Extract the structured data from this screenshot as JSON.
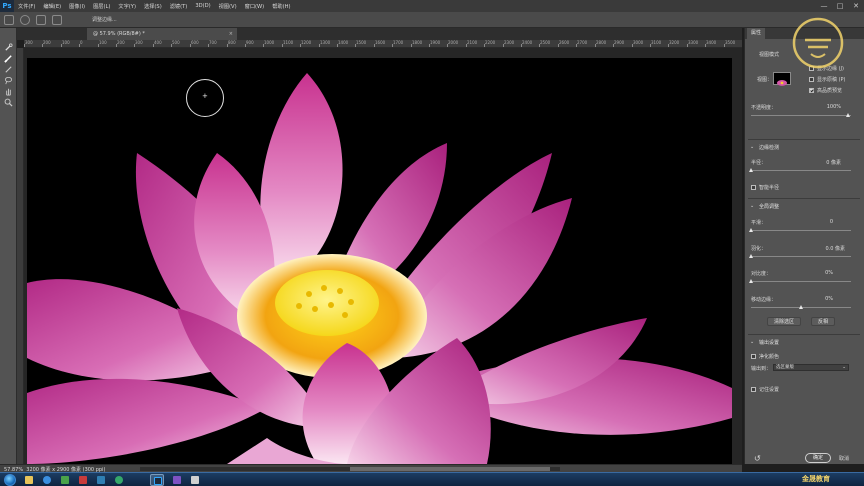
{
  "app": {
    "logo": "Ps"
  },
  "menubar": {
    "items": [
      "文件(F)",
      "编辑(E)",
      "图像(I)",
      "图层(L)",
      "文字(Y)",
      "选择(S)",
      "滤镜(T)",
      "3D(D)",
      "视图(V)",
      "窗口(W)",
      "帮助(H)"
    ],
    "window_controls": [
      "—",
      "□",
      "✕"
    ]
  },
  "options_bar": {
    "partial_label": "调整边缘..."
  },
  "document": {
    "tab_label": "@ 57.9% (RGB/8#) *",
    "close": "×"
  },
  "ruler_h": {
    "ticks": [
      "300",
      "200",
      "100",
      "0",
      "100",
      "200",
      "300",
      "400",
      "500",
      "600",
      "700",
      "800",
      "900",
      "1000",
      "1100",
      "1200",
      "1300",
      "1400",
      "1500",
      "1600",
      "1700",
      "1800",
      "1900",
      "2000",
      "2100",
      "2200",
      "2300",
      "2400",
      "2500",
      "2600",
      "2700",
      "2800",
      "2900",
      "3000",
      "3100",
      "3200",
      "3300",
      "3400",
      "3500"
    ]
  },
  "status": {
    "zoom": "57.87%",
    "doc_size": "3200 像素 x 2900 像素 (300 ppi)"
  },
  "panel": {
    "tab": "属性",
    "view_mode": {
      "title": "视图模式",
      "view_label": "视图：",
      "show_edge": "显示边缘 (J)",
      "show_original": "显示原稿 (P)",
      "high_quality": "高品质预览",
      "show_edge_checked": false,
      "show_original_checked": false,
      "high_quality_checked": true
    },
    "opacity": {
      "label": "不透明度：",
      "value": "100%"
    },
    "edge_detection": {
      "title": "边缘检测",
      "radius_label": "半径：",
      "radius_value": "0 像素",
      "smart_radius": "智能半径",
      "smart_radius_checked": false
    },
    "global_refine": {
      "title": "全局调整",
      "smooth_label": "平滑：",
      "smooth_value": "0",
      "feather_label": "羽化：",
      "feather_value": "0.0 像素",
      "contrast_label": "对比度：",
      "contrast_value": "0%",
      "shift_edge_label": "移动边缘：",
      "shift_edge_value": "0%"
    },
    "buttons": {
      "clear_selection": "清除选区",
      "invert": "反相"
    },
    "output": {
      "title": "输出设置",
      "decontaminate": "净化颜色",
      "decontaminate_checked": false,
      "output_to_label": "输出到：",
      "output_to_value": "选区蒙版",
      "remember": "记住设置",
      "remember_checked": false
    },
    "ok": "确定",
    "cancel": "取消"
  },
  "watermark": {
    "brand_text": "金晟教育"
  },
  "colors": {
    "menubar": "#3a3a3a",
    "panel": "#535353",
    "canvas_bg": "#000000",
    "taskbar": "#1c3d63",
    "accent": "#31a8ff"
  }
}
